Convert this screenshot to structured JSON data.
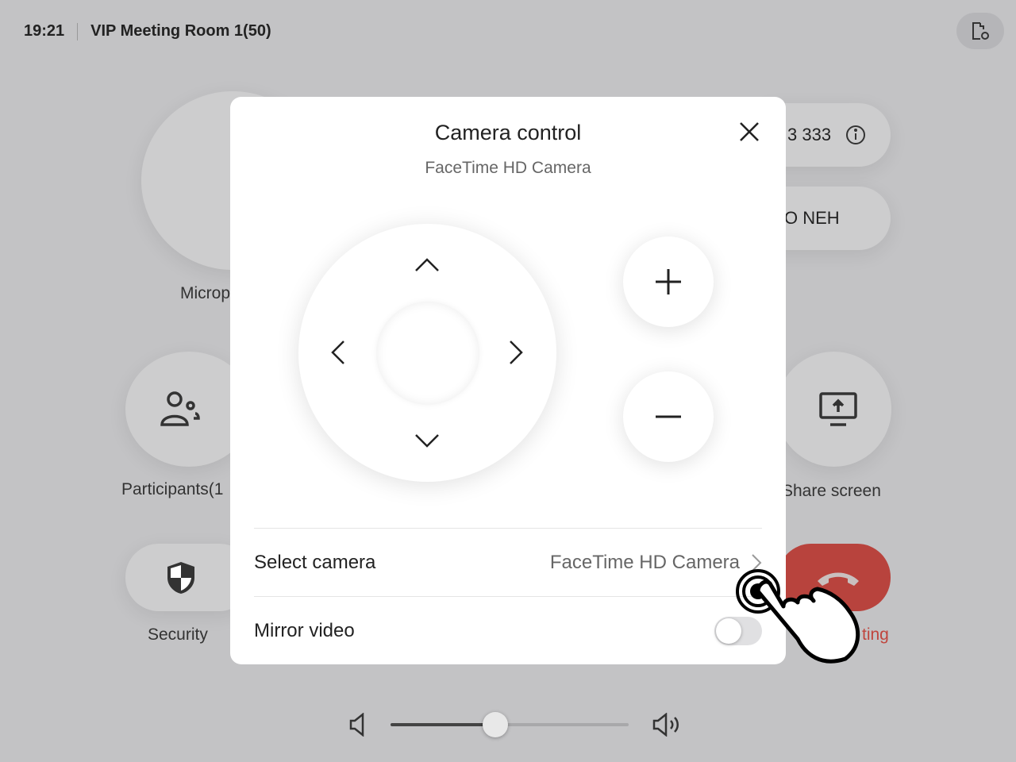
{
  "header": {
    "time": "19:21",
    "room": "VIP Meeting Room 1(50)",
    "settings_icon": "room-settings-icon"
  },
  "background": {
    "microphone_label": "Microp",
    "participants_label": "Participants(1",
    "security_label": "Security",
    "meeting_id": "3 333",
    "passcode": "O NEH",
    "share_label": "Share screen",
    "leave_label": "ting",
    "accent": "#b8433d"
  },
  "modal": {
    "title": "Camera control",
    "subtitle": "FaceTime HD Camera",
    "select_camera_label": "Select camera",
    "select_camera_value": "FaceTime HD Camera",
    "mirror_label": "Mirror video",
    "mirror_on": false
  },
  "volume": {
    "level": 0.44
  }
}
